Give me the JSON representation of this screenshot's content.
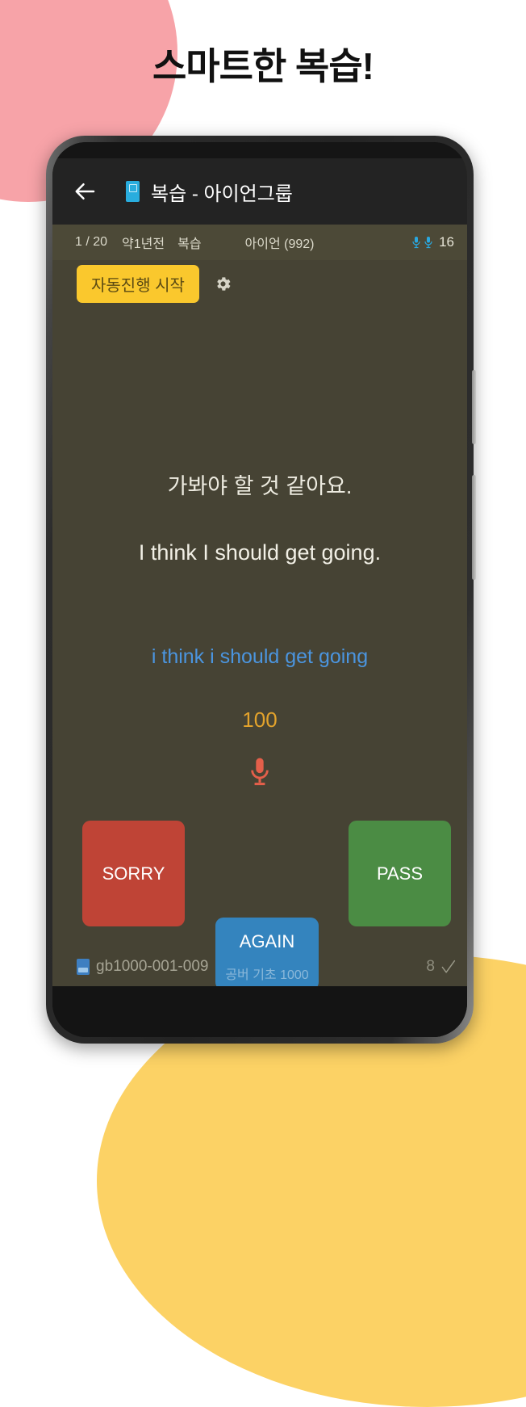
{
  "headline": "스마트한 복습!",
  "decor": {
    "pink_color": "#F7A3A8",
    "yellow_color": "#FCD265"
  },
  "appbar": {
    "back_icon": "back-arrow-icon",
    "app_icon": "book-app-icon",
    "title": "복습 - 아이언그룹"
  },
  "status": {
    "index": "1 / 20",
    "when": "약1년전",
    "mode": "복습",
    "owner": "아이언 (992)",
    "mic_icon": "microphone-icon",
    "mic_count": "16"
  },
  "toolbar": {
    "autoplay_label": "자동진행 시작",
    "gear_icon": "gear-icon"
  },
  "card": {
    "korean": "가봐야 할 것 같아요.",
    "english": "I think I should get going.",
    "recognized": "i think i should get going",
    "score": "100",
    "record_icon": "microphone-icon",
    "recognized_color": "#4B95DF",
    "score_color": "#E3A32C",
    "record_icon_color": "#E45F4A"
  },
  "answers": {
    "sorry_label": "SORRY",
    "sorry_color": "#BF4436",
    "pass_label": "PASS",
    "pass_color": "#4B8C44",
    "again_label": "AGAIN",
    "again_sub_label": "공버 기초 1000",
    "again_color": "#3484BE"
  },
  "footer": {
    "book_icon": "book-icon",
    "code": "gb1000-001-009",
    "count": "8",
    "check_icon": "check-icon"
  }
}
